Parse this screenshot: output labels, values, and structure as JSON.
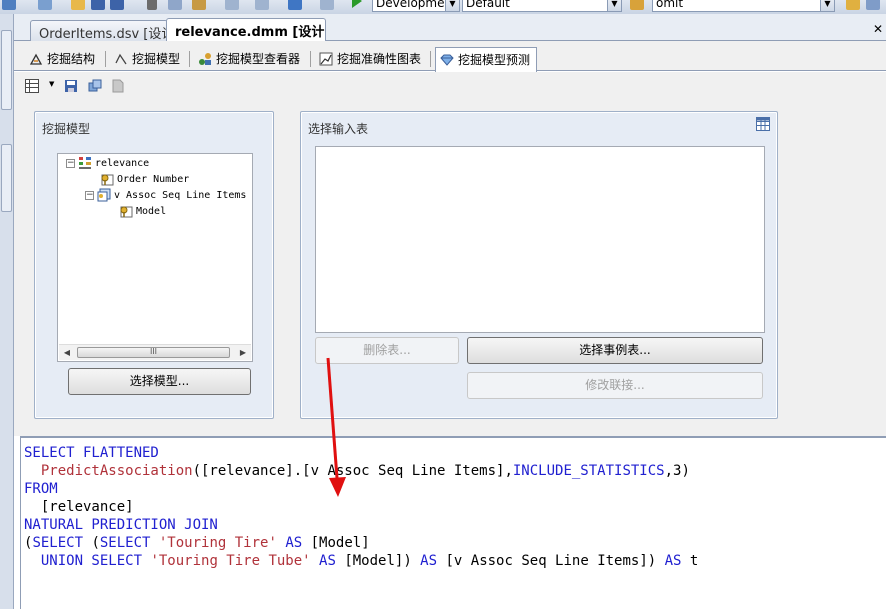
{
  "toolbar": {
    "config_combo": "Developmer",
    "platform_combo": "Default",
    "find_combo": "omit",
    "icons": [
      "new-project-icon",
      "add-item-icon",
      "open-icon",
      "save-icon",
      "save-all-icon",
      "cut-icon",
      "copy-icon",
      "paste-icon",
      "undo-icon",
      "redo-icon",
      "navigate-back-icon",
      "start-debug-icon",
      "find-icon",
      "solution-explorer-icon"
    ]
  },
  "doc_tabs": [
    {
      "label": "OrderItems.dsv [设计]",
      "active": false
    },
    {
      "label": "relevance.dmm [设计]",
      "active": true
    }
  ],
  "design_tabs": [
    {
      "label": "挖掘结构",
      "icon": "mining-structure-icon"
    },
    {
      "label": "挖掘模型",
      "icon": "mining-models-icon"
    },
    {
      "label": "挖掘模型查看器",
      "icon": "model-viewer-icon"
    },
    {
      "label": "挖掘准确性图表",
      "icon": "accuracy-chart-icon"
    },
    {
      "label": "挖掘模型预测",
      "icon": "prediction-icon",
      "active": true
    }
  ],
  "mining_model_panel": {
    "title": "挖掘模型",
    "tree": [
      {
        "label": "relevance",
        "icon": "mining-structure-icon",
        "expander": "−"
      },
      {
        "label": "Order Number",
        "icon": "key-column-icon"
      },
      {
        "label": "v Assoc Seq Line Items",
        "icon": "nested-table-icon",
        "expander": "−"
      },
      {
        "label": "Model",
        "icon": "key-column-icon"
      }
    ],
    "scroll_thumb": "III",
    "select_model_button": "选择模型..."
  },
  "input_table_panel": {
    "title": "选择输入表",
    "delete_table_button": "删除表...",
    "select_case_table_button": "选择事例表...",
    "modify_join_button": "修改联接..."
  },
  "query": {
    "lines": [
      [
        {
          "t": "SELECT FLATTENED",
          "c": "kw"
        }
      ],
      [
        {
          "t": "  PredictAssociation",
          "c": "str"
        },
        {
          "t": "([relevance].[v Assoc Seq Line Items],",
          "c": "txt"
        },
        {
          "t": "INCLUDE_STATISTICS",
          "c": "kw"
        },
        {
          "t": ",3)",
          "c": "txt"
        }
      ],
      [
        {
          "t": "FROM",
          "c": "kw"
        }
      ],
      [
        {
          "t": "  [relevance]",
          "c": "txt"
        }
      ],
      [
        {
          "t": "NATURAL PREDICTION JOIN",
          "c": "kw"
        }
      ],
      [
        {
          "t": "(",
          "c": "txt"
        },
        {
          "t": "SELECT",
          "c": "kw"
        },
        {
          "t": " (",
          "c": "txt"
        },
        {
          "t": "SELECT",
          "c": "kw"
        },
        {
          "t": " 'Touring Tire'",
          "c": "str"
        },
        {
          "t": " AS",
          "c": "kw"
        },
        {
          "t": " [Model]",
          "c": "txt"
        }
      ],
      [
        {
          "t": "  UNION SELECT",
          "c": "kw"
        },
        {
          "t": " 'Touring Tire Tube'",
          "c": "str"
        },
        {
          "t": " AS",
          "c": "kw"
        },
        {
          "t": " [Model])",
          "c": "txt"
        },
        {
          "t": " AS",
          "c": "kw"
        },
        {
          "t": " [v Assoc Seq Line Items])",
          "c": "txt"
        },
        {
          "t": " AS",
          "c": "kw"
        },
        {
          "t": " t",
          "c": "txt"
        }
      ]
    ]
  },
  "colors": {
    "keyword": "#2020d0",
    "function": "#b0323a",
    "annotation_arrow": "#e01010"
  }
}
